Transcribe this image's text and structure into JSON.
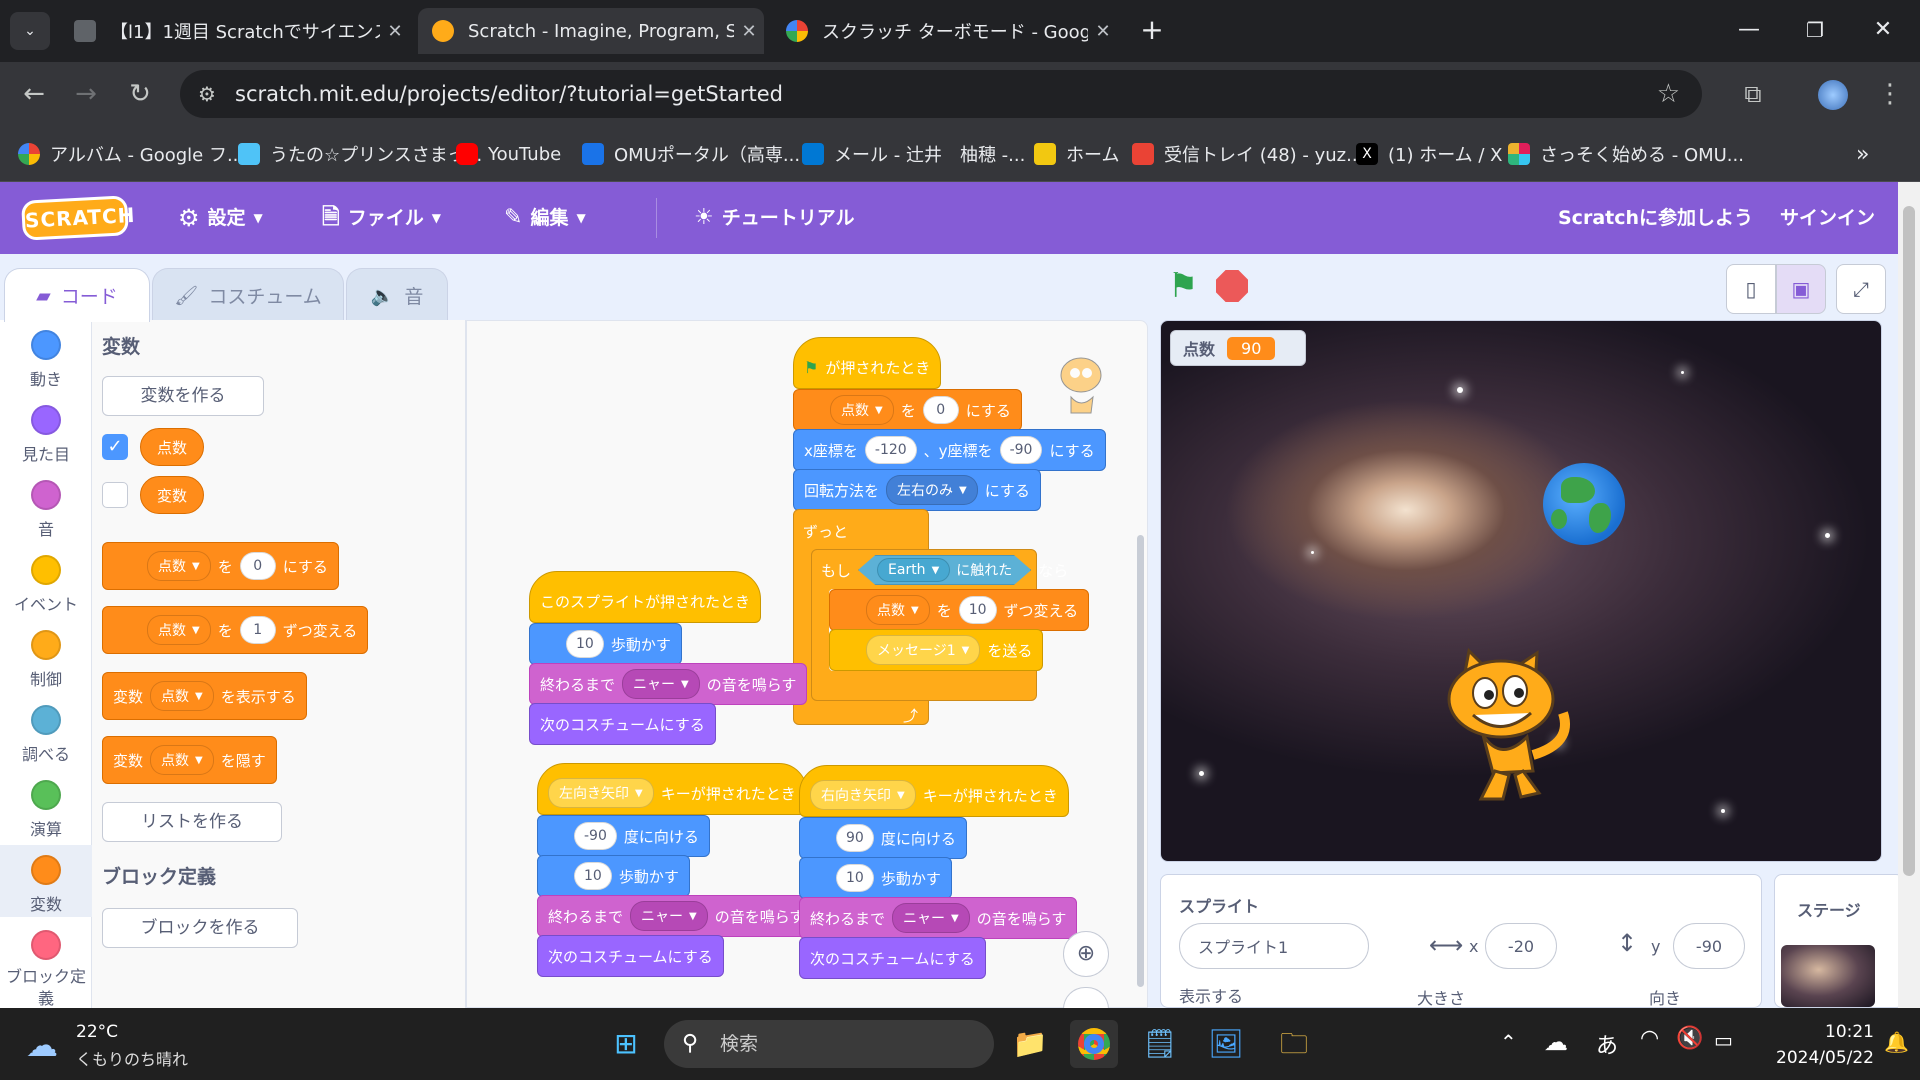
{
  "browser": {
    "tabs": [
      {
        "title": "【l1】1週目 Scratchでサイエンスアー",
        "icon": "classroom-icon"
      },
      {
        "title": "Scratch - Imagine, Program, Sha",
        "icon": "scratch-icon"
      },
      {
        "title": "スクラッチ ターボモード - Google 検",
        "icon": "google-icon"
      }
    ],
    "url": "scratch.mit.edu/projects/editor/?tutorial=getStarted",
    "bookmarks": [
      {
        "label": "アルバム - Google フ...",
        "color": "#ea4335"
      },
      {
        "label": "うたの☆プリンスさまっ...",
        "color": "#4fc3f7"
      },
      {
        "label": "YouTube",
        "color": "#ff0000"
      },
      {
        "label": "OMUポータル（高専...",
        "color": "#1a73e8"
      },
      {
        "label": "メール - 辻井　柚穂 -...",
        "color": "#0078d4"
      },
      {
        "label": "ホーム",
        "color": "#f2c811"
      },
      {
        "label": "受信トレイ (48) - yuz...",
        "color": "#ea4335"
      },
      {
        "label": "(1) ホーム / X",
        "color": "#000000"
      },
      {
        "label": "さっそく始める - OMU...",
        "color": "#e01e5a"
      }
    ],
    "more_bookmarks": "»"
  },
  "scratch": {
    "logo": "SCRATCH",
    "menu": {
      "settings": "設定",
      "file": "ファイル",
      "edit": "編集",
      "tutorial": "チュートリアル",
      "join": "Scratchに参加しよう",
      "signin": "サインイン"
    },
    "tabs": {
      "code": "コード",
      "costumes": "コスチューム",
      "sounds": "音"
    },
    "categories": [
      {
        "label": "動き",
        "color": "#4c97ff"
      },
      {
        "label": "見た目",
        "color": "#9966ff"
      },
      {
        "label": "音",
        "color": "#cf63cf"
      },
      {
        "label": "イベント",
        "color": "#ffbf00"
      },
      {
        "label": "制御",
        "color": "#ffab19"
      },
      {
        "label": "調べる",
        "color": "#5cb1d6"
      },
      {
        "label": "演算",
        "color": "#59c059"
      },
      {
        "label": "変数",
        "color": "#ff8c1a"
      },
      {
        "label": "ブロック定義",
        "color": "#ff6680"
      }
    ],
    "palette": {
      "heading_vars": "変数",
      "make_var": "変数を作る",
      "var1": "点数",
      "var2": "変数",
      "set_label_to": "を",
      "set_label_end": "にする",
      "set_value": "0",
      "change_label_end": "ずつ変える",
      "change_value": "1",
      "show_prefix": "変数",
      "show_suffix": "を表示する",
      "hide_suffix": "を隠す",
      "make_list": "リストを作る",
      "heading_blocks": "ブロック定義",
      "make_block": "ブロックを作る"
    },
    "script_main": {
      "hat": "が押されたとき",
      "set_var": "点数",
      "set_to": "を",
      "set_val": "0",
      "set_end": "にする",
      "goto_x_label": "x座標を",
      "goto_x": "-120",
      "goto_y_label": "、y座標を",
      "goto_y": "-90",
      "goto_end": "にする",
      "rot_label": "回転方法を",
      "rot_val": "左右のみ",
      "rot_end": "にする",
      "forever": "ずっと",
      "if": "もし",
      "touch_obj": "Earth",
      "touch_label": "に触れた",
      "then": "なら",
      "change_var": "点数",
      "change_to": "を",
      "change_val": "10",
      "change_end": "ずつ変える",
      "broadcast": "メッセージ1",
      "broadcast_end": "を送る"
    },
    "script_click": {
      "hat": "このスプライトが押されたとき",
      "move_val": "10",
      "move_label": "歩動かす",
      "sound_prefix": "終わるまで",
      "sound": "ニャー",
      "sound_suffix": "の音を鳴らす",
      "next_costume": "次のコスチュームにする"
    },
    "script_left": {
      "key": "左向き矢印",
      "hat": "キーが押されたとき",
      "dir_val": "-90",
      "dir_label": "度に向ける",
      "move_val": "10",
      "move_label": "歩動かす",
      "sound_prefix": "終わるまで",
      "sound": "ニャー",
      "sound_suffix": "の音を鳴らす",
      "next_costume": "次のコスチュームにする"
    },
    "script_right": {
      "key": "右向き矢印",
      "hat": "キーが押されたとき",
      "dir_val": "90",
      "dir_label": "度に向ける",
      "move_val": "10",
      "move_label": "歩動かす",
      "sound_prefix": "終わるまで",
      "sound": "ニャー",
      "sound_suffix": "の音を鳴らす",
      "next_costume": "次のコスチュームにする"
    },
    "monitor": {
      "label": "点数",
      "value": "90"
    },
    "sprite_panel": {
      "title": "スプライト",
      "name": "スプライト1",
      "x_label": "x",
      "x": "-20",
      "y_label": "y",
      "y": "-90",
      "show": "表示する",
      "size": "大きさ",
      "direction": "向き"
    },
    "stage_panel": {
      "title": "ステージ"
    }
  },
  "taskbar": {
    "weather_temp": "22°C",
    "weather_desc": "くもりのち晴れ",
    "search_placeholder": "検索",
    "ime": "あ",
    "time": "10:21",
    "date": "2024/05/22"
  }
}
